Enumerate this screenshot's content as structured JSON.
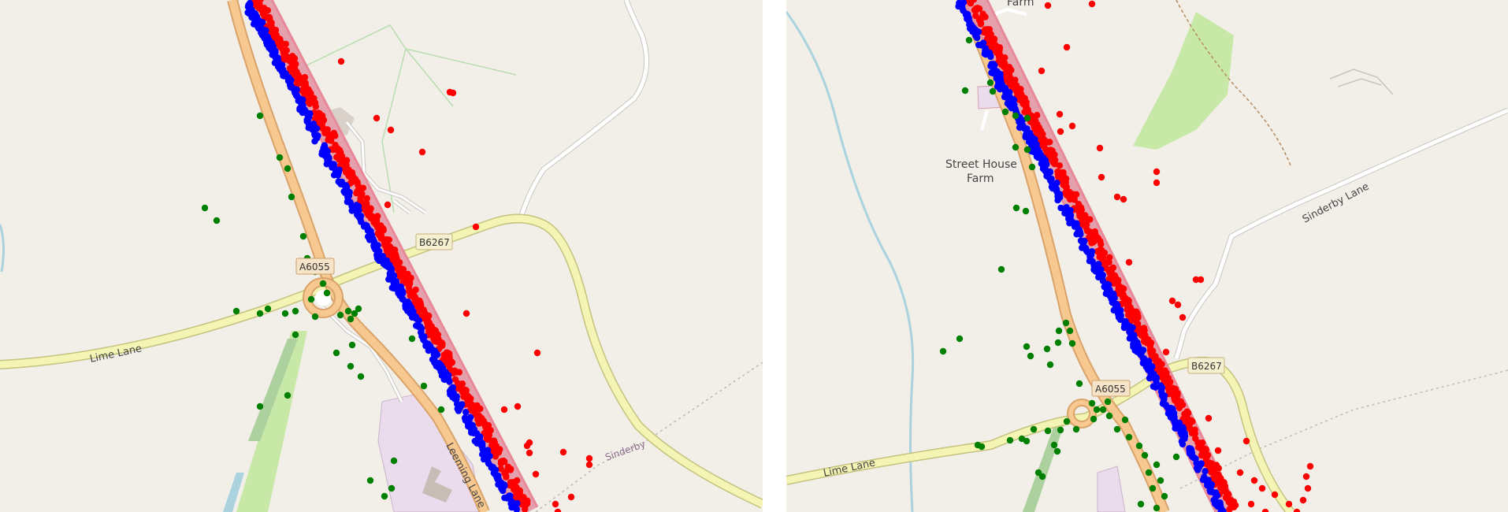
{
  "maps": [
    {
      "id": "left",
      "labels": {
        "lime_lane": "Lime Lane",
        "b_road": "B6267",
        "a_road": "A6055",
        "sinderby": "Sinderby",
        "leeming_lane": "Leeming Lane"
      }
    },
    {
      "id": "right",
      "labels": {
        "street_house_farm_1": "Street House",
        "street_house_farm_2": "Farm",
        "farm_top": "Farm",
        "sinderby_lane": "Sinderby Lane",
        "lime_lane": "Lime Lane",
        "b_road": "B6267",
        "a_road": "A6055"
      }
    }
  ],
  "colors": {
    "background": "#f2efe9",
    "motorway_casing": "#e8899a",
    "motorway_fill": "#e4a0ac",
    "trunk_fill": "#f7c88f",
    "trunk_casing": "#d9a36a",
    "secondary_fill": "#f4f5b4",
    "secondary_casing": "#c3c27e",
    "minor_road": "#ffffff",
    "minor_casing": "#c8c6c2",
    "water": "#aad3df",
    "grass": "#c8e8a8",
    "wood": "#add19e",
    "building": "#d9d0c9",
    "landuse_pink": "#eadcec",
    "track": "#b58b5c",
    "red_points": "#ff0000",
    "blue_points": "#0000ff",
    "green_points": "#008000"
  }
}
